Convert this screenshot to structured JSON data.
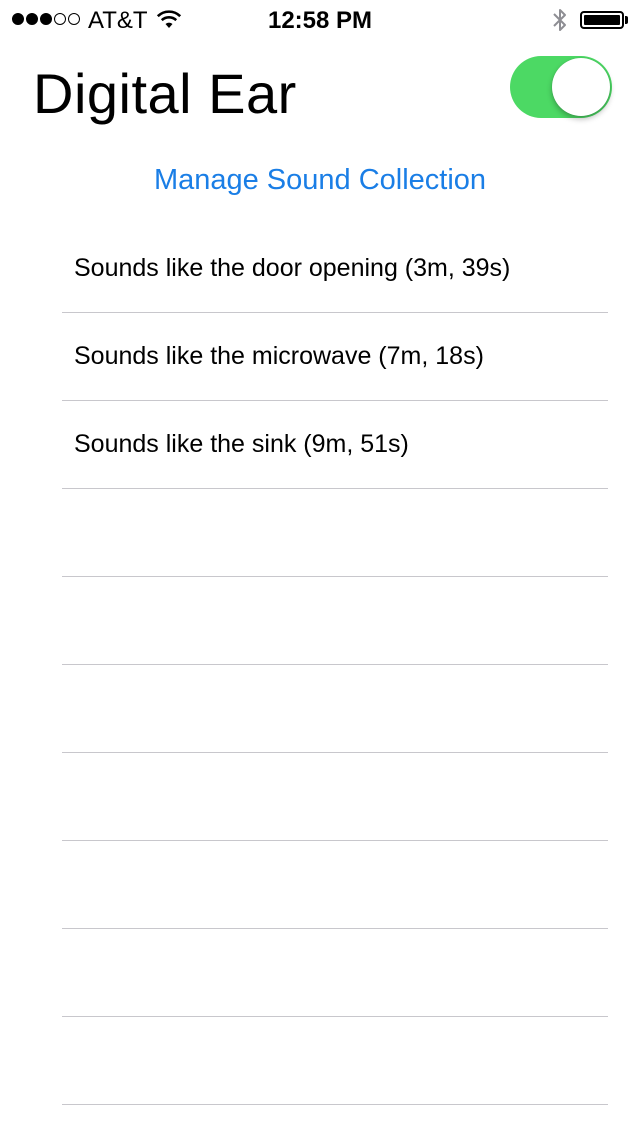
{
  "status_bar": {
    "signal_bars": [
      true,
      true,
      true,
      false,
      false
    ],
    "carrier": "AT&T",
    "time": "12:58 PM",
    "wifi_icon": "wifi-icon",
    "bluetooth_icon": "bluetooth-icon",
    "battery_level": 1.0
  },
  "header": {
    "title": "Digital Ear",
    "toggle_on": true,
    "toggle_color": "#4cd964"
  },
  "manage_link": {
    "label": "Manage Sound Collection",
    "color": "#1a7ee6"
  },
  "sound_list": {
    "items": [
      "Sounds like the door opening (3m, 39s)",
      "Sounds like the microwave (7m, 18s)",
      "Sounds like the sink (9m, 51s)",
      "",
      "",
      "",
      "",
      "",
      "",
      ""
    ]
  }
}
